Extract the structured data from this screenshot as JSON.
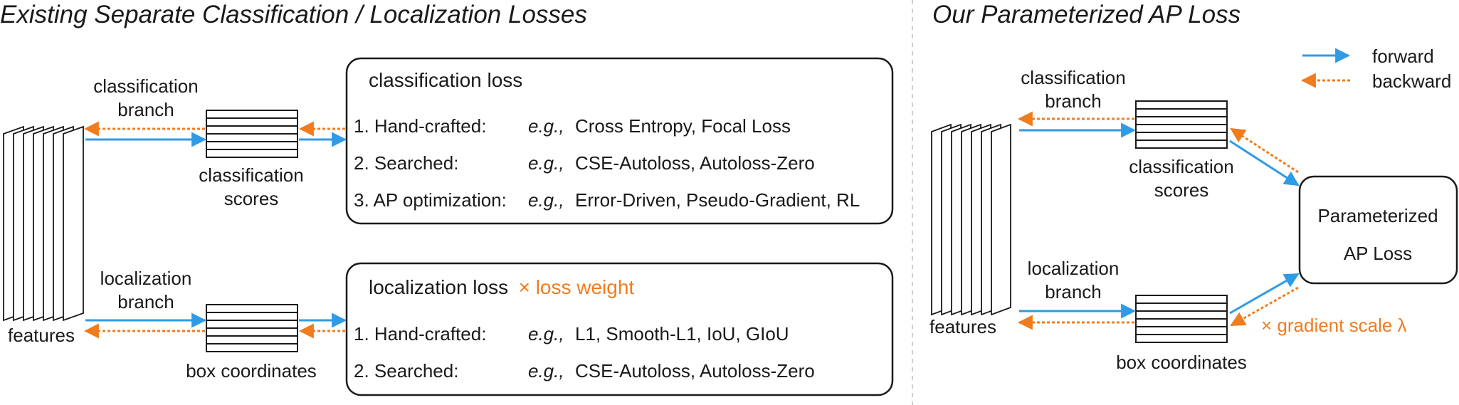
{
  "left_panel": {
    "title": "Existing Separate Classification / Localization Losses",
    "classification_branch_label": [
      "classification",
      "branch"
    ],
    "classification_scores_label": [
      "classification",
      "scores"
    ],
    "localization_branch_label": [
      "localization",
      "branch"
    ],
    "box_coordinates_label": "box coordinates",
    "features_label": "features",
    "classification_loss": {
      "heading": "classification loss",
      "rows": [
        {
          "method": "1. Hand-crafted:",
          "eg": "e.g.,",
          "examples": "Cross Entropy, Focal Loss"
        },
        {
          "method": "2. Searched:",
          "eg": "e.g.,",
          "examples": "CSE-Autoloss, Autoloss-Zero"
        },
        {
          "method": "3. AP optimization:",
          "eg": "e.g.,",
          "examples": "Error-Driven, Pseudo-Gradient, RL"
        }
      ]
    },
    "localization_loss": {
      "heading": "localization loss",
      "weight": "× loss weight",
      "rows": [
        {
          "method": "1. Hand-crafted:",
          "eg": "e.g.,",
          "examples": "L1, Smooth-L1, IoU, GIoU"
        },
        {
          "method": "2. Searched:",
          "eg": "e.g.,",
          "examples": "CSE-Autoloss, Autoloss-Zero"
        }
      ]
    }
  },
  "right_panel": {
    "title": "Our Parameterized AP Loss",
    "legend": {
      "forward": "forward",
      "backward": "backward"
    },
    "classification_branch_label": [
      "classification",
      "branch"
    ],
    "classification_scores_label": [
      "classification",
      "scores"
    ],
    "localization_branch_label": [
      "localization",
      "branch"
    ],
    "box_coordinates_label": "box coordinates",
    "features_label": "features",
    "ap_loss_label": [
      "Parameterized",
      "AP Loss"
    ],
    "gradient_scale": "× gradient scale λ"
  },
  "colors": {
    "forward": "#2f9be6",
    "backward": "#f07c1e",
    "accent_text": "#f07c1e"
  }
}
